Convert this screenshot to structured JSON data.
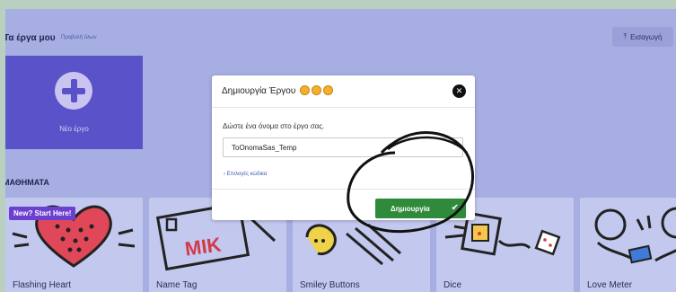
{
  "header": {
    "projects_title": "Τα έργα μου",
    "view_all": "Προβολή όλων",
    "import_label": "Εισαγωγή",
    "import_icon": "upload-icon"
  },
  "new_project": {
    "label": "Νέο έργο",
    "icon": "plus-icon"
  },
  "lessons": {
    "title": "ΜΑΘΗΜΑΤΑ",
    "badge": "New? Start Here!",
    "cards": [
      {
        "label": "Flashing Heart"
      },
      {
        "label": "Name Tag"
      },
      {
        "label": "Smiley Buttons"
      },
      {
        "label": "Dice"
      },
      {
        "label": "Love Meter"
      }
    ]
  },
  "modal": {
    "title": "Δημιουργία Έργου",
    "prompt": "Δώστε ένα όνομα στο έργο σας.",
    "input_value": "ToOnomaSas_Temp",
    "code_options": "Επιλογές κώδικα",
    "create_label": "Δημιουργία"
  },
  "colors": {
    "page_bg": "#a7aee2",
    "new_project_bg": "#5a52c8",
    "create_button": "#2f8a3b",
    "badge": "#6b3fd0"
  }
}
